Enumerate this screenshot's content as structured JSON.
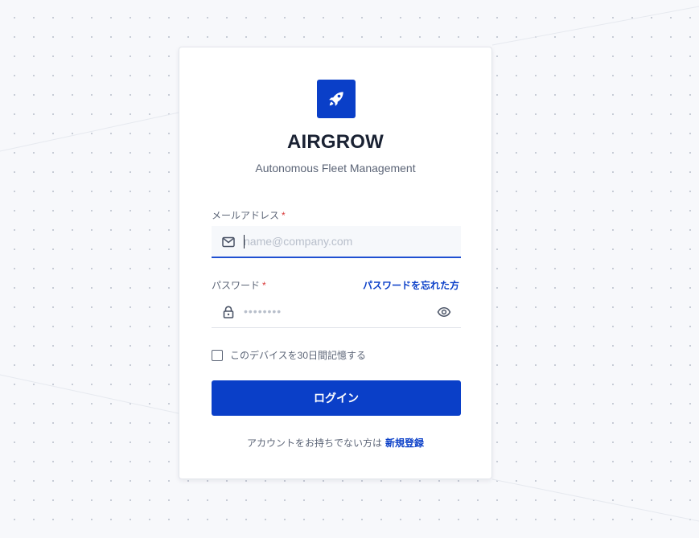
{
  "brand": {
    "name": "AIRGROW",
    "tagline": "Autonomous Fleet Management",
    "logo_icon": "rocket-icon"
  },
  "form": {
    "email": {
      "label": "メールアドレス",
      "required_mark": "*",
      "placeholder": "name@company.com",
      "value": "",
      "icon": "mail-icon"
    },
    "password": {
      "label": "パスワード",
      "required_mark": "*",
      "placeholder": "••••••••",
      "value": "",
      "icon": "lock-icon",
      "toggle_icon": "eye-icon",
      "forgot_link": "パスワードを忘れた方"
    },
    "remember": {
      "label": "このデバイスを30日間記憶する",
      "checked": false
    },
    "submit_label": "ログイン"
  },
  "signup": {
    "prompt": "アカウントをお持ちでない方は",
    "link": "新規登録"
  },
  "colors": {
    "primary": "#0a3fc8",
    "background": "#f7f8fb",
    "text_dark": "#1a2233",
    "text_muted": "#5c6577",
    "required": "#d93a3a"
  }
}
